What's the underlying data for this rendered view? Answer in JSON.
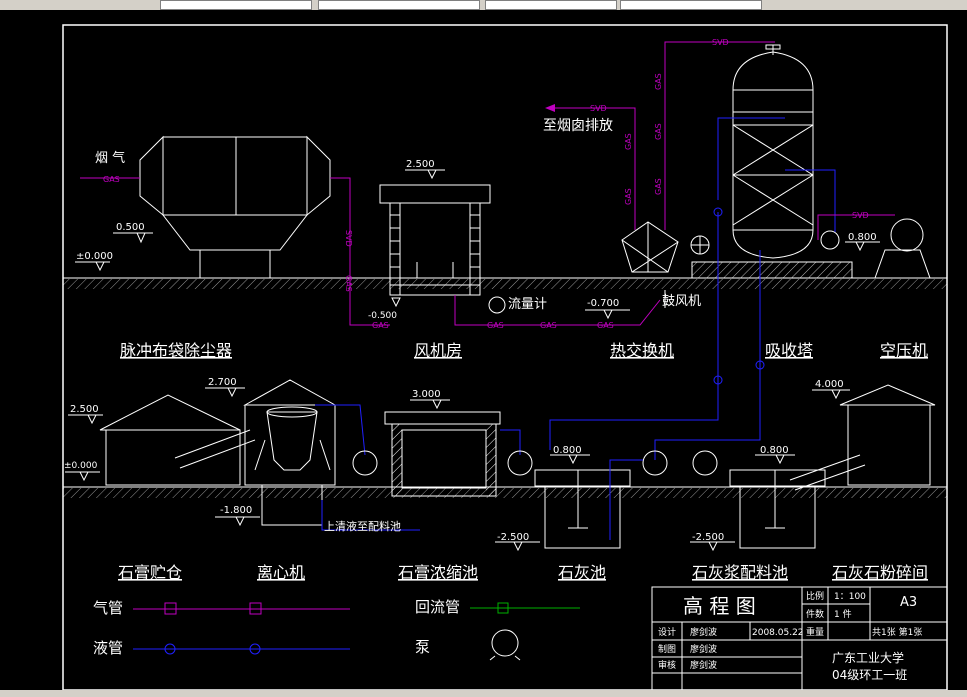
{
  "labels": {
    "yanqi": "烟 气",
    "to_chimney": "至烟囱排放",
    "flowmeter": "流量计",
    "blower": "鼓风机",
    "return_to_tank": "上清液至配料池"
  },
  "pipe_tags": {
    "gas": "GAS",
    "svd": "SVD"
  },
  "elevations": {
    "e_0500": "0.500",
    "e_pm0000_a": "±0.000",
    "e_2500_top": "2.500",
    "e_m0500": "-0.500",
    "e_m0700": "-0.700",
    "e_0800_top": "0.800",
    "e_2700": "2.700",
    "e_2500_mid": "2.500",
    "e_pm0000_b": "±0.000",
    "e_3000": "3.000",
    "e_m1800": "-1.800",
    "e_0800_a": "0.800",
    "e_0800_b": "0.800",
    "e_m2500_a": "-2.500",
    "e_m2500_b": "-2.500",
    "e_4000": "4.000"
  },
  "equipment_names": {
    "bag_filter": "脉冲布袋除尘器",
    "fan_room": "风机房",
    "heat_exchanger": "热交换机",
    "absorber": "吸收塔",
    "compressor": "空压机",
    "gypsum_silo": "石膏贮仓",
    "centrifuge": "离心机",
    "gypsum_thickener": "石膏浓缩池",
    "lime_tank": "石灰池",
    "slurry_tank": "石灰浆配料池",
    "limestone_crusher": "石灰石粉碎间"
  },
  "legend": {
    "gas_pipe": "气管",
    "liquid_pipe": "液管",
    "return_pipe": "回流管",
    "pump": "泵"
  },
  "title_block": {
    "title": "高 程 图",
    "scale_label": "比例",
    "scale_value": "1：100",
    "count_label": "件数",
    "count_value": "1 件",
    "sheet_size": "A3",
    "design_label": "设计",
    "design_name": "廖剑波",
    "design_date": "2008.05.22",
    "weight_label": "重量",
    "sheets": "共1张  第1张",
    "draw_label": "制图",
    "draw_name": "廖剑波",
    "review_label": "审核",
    "review_name": "廖剑波",
    "school": "广东工业大学",
    "class_name": "04级环工一班"
  },
  "colors": {
    "gas": "#c000c0",
    "liquid": "#2020ff",
    "return": "#00b000",
    "line": "#ffffff"
  }
}
